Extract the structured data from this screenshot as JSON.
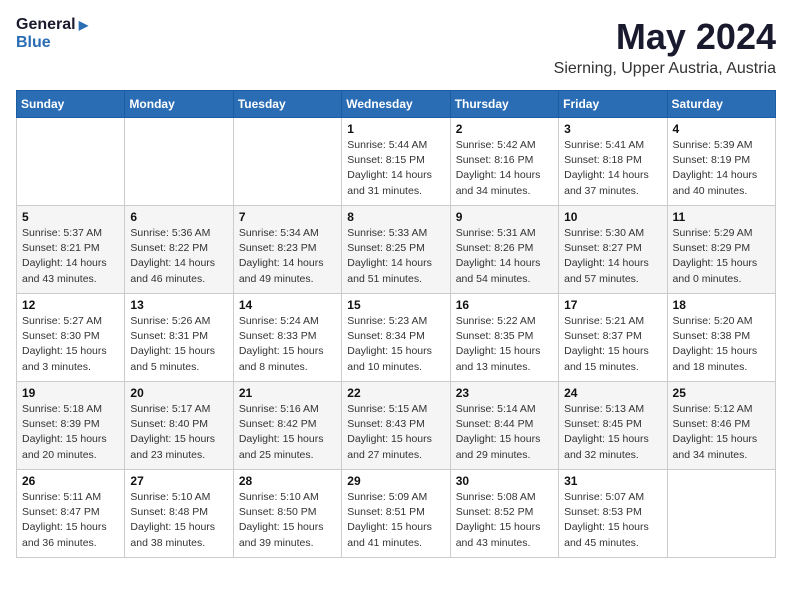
{
  "logo": {
    "line1": "General",
    "line2": "Blue"
  },
  "title": "May 2024",
  "subtitle": "Sierning, Upper Austria, Austria",
  "days_header": [
    "Sunday",
    "Monday",
    "Tuesday",
    "Wednesday",
    "Thursday",
    "Friday",
    "Saturday"
  ],
  "weeks": [
    [
      {
        "day": "",
        "info": ""
      },
      {
        "day": "",
        "info": ""
      },
      {
        "day": "",
        "info": ""
      },
      {
        "day": "1",
        "info": "Sunrise: 5:44 AM\nSunset: 8:15 PM\nDaylight: 14 hours\nand 31 minutes."
      },
      {
        "day": "2",
        "info": "Sunrise: 5:42 AM\nSunset: 8:16 PM\nDaylight: 14 hours\nand 34 minutes."
      },
      {
        "day": "3",
        "info": "Sunrise: 5:41 AM\nSunset: 8:18 PM\nDaylight: 14 hours\nand 37 minutes."
      },
      {
        "day": "4",
        "info": "Sunrise: 5:39 AM\nSunset: 8:19 PM\nDaylight: 14 hours\nand 40 minutes."
      }
    ],
    [
      {
        "day": "5",
        "info": "Sunrise: 5:37 AM\nSunset: 8:21 PM\nDaylight: 14 hours\nand 43 minutes."
      },
      {
        "day": "6",
        "info": "Sunrise: 5:36 AM\nSunset: 8:22 PM\nDaylight: 14 hours\nand 46 minutes."
      },
      {
        "day": "7",
        "info": "Sunrise: 5:34 AM\nSunset: 8:23 PM\nDaylight: 14 hours\nand 49 minutes."
      },
      {
        "day": "8",
        "info": "Sunrise: 5:33 AM\nSunset: 8:25 PM\nDaylight: 14 hours\nand 51 minutes."
      },
      {
        "day": "9",
        "info": "Sunrise: 5:31 AM\nSunset: 8:26 PM\nDaylight: 14 hours\nand 54 minutes."
      },
      {
        "day": "10",
        "info": "Sunrise: 5:30 AM\nSunset: 8:27 PM\nDaylight: 14 hours\nand 57 minutes."
      },
      {
        "day": "11",
        "info": "Sunrise: 5:29 AM\nSunset: 8:29 PM\nDaylight: 15 hours\nand 0 minutes."
      }
    ],
    [
      {
        "day": "12",
        "info": "Sunrise: 5:27 AM\nSunset: 8:30 PM\nDaylight: 15 hours\nand 3 minutes."
      },
      {
        "day": "13",
        "info": "Sunrise: 5:26 AM\nSunset: 8:31 PM\nDaylight: 15 hours\nand 5 minutes."
      },
      {
        "day": "14",
        "info": "Sunrise: 5:24 AM\nSunset: 8:33 PM\nDaylight: 15 hours\nand 8 minutes."
      },
      {
        "day": "15",
        "info": "Sunrise: 5:23 AM\nSunset: 8:34 PM\nDaylight: 15 hours\nand 10 minutes."
      },
      {
        "day": "16",
        "info": "Sunrise: 5:22 AM\nSunset: 8:35 PM\nDaylight: 15 hours\nand 13 minutes."
      },
      {
        "day": "17",
        "info": "Sunrise: 5:21 AM\nSunset: 8:37 PM\nDaylight: 15 hours\nand 15 minutes."
      },
      {
        "day": "18",
        "info": "Sunrise: 5:20 AM\nSunset: 8:38 PM\nDaylight: 15 hours\nand 18 minutes."
      }
    ],
    [
      {
        "day": "19",
        "info": "Sunrise: 5:18 AM\nSunset: 8:39 PM\nDaylight: 15 hours\nand 20 minutes."
      },
      {
        "day": "20",
        "info": "Sunrise: 5:17 AM\nSunset: 8:40 PM\nDaylight: 15 hours\nand 23 minutes."
      },
      {
        "day": "21",
        "info": "Sunrise: 5:16 AM\nSunset: 8:42 PM\nDaylight: 15 hours\nand 25 minutes."
      },
      {
        "day": "22",
        "info": "Sunrise: 5:15 AM\nSunset: 8:43 PM\nDaylight: 15 hours\nand 27 minutes."
      },
      {
        "day": "23",
        "info": "Sunrise: 5:14 AM\nSunset: 8:44 PM\nDaylight: 15 hours\nand 29 minutes."
      },
      {
        "day": "24",
        "info": "Sunrise: 5:13 AM\nSunset: 8:45 PM\nDaylight: 15 hours\nand 32 minutes."
      },
      {
        "day": "25",
        "info": "Sunrise: 5:12 AM\nSunset: 8:46 PM\nDaylight: 15 hours\nand 34 minutes."
      }
    ],
    [
      {
        "day": "26",
        "info": "Sunrise: 5:11 AM\nSunset: 8:47 PM\nDaylight: 15 hours\nand 36 minutes."
      },
      {
        "day": "27",
        "info": "Sunrise: 5:10 AM\nSunset: 8:48 PM\nDaylight: 15 hours\nand 38 minutes."
      },
      {
        "day": "28",
        "info": "Sunrise: 5:10 AM\nSunset: 8:50 PM\nDaylight: 15 hours\nand 39 minutes."
      },
      {
        "day": "29",
        "info": "Sunrise: 5:09 AM\nSunset: 8:51 PM\nDaylight: 15 hours\nand 41 minutes."
      },
      {
        "day": "30",
        "info": "Sunrise: 5:08 AM\nSunset: 8:52 PM\nDaylight: 15 hours\nand 43 minutes."
      },
      {
        "day": "31",
        "info": "Sunrise: 5:07 AM\nSunset: 8:53 PM\nDaylight: 15 hours\nand 45 minutes."
      },
      {
        "day": "",
        "info": ""
      }
    ]
  ]
}
